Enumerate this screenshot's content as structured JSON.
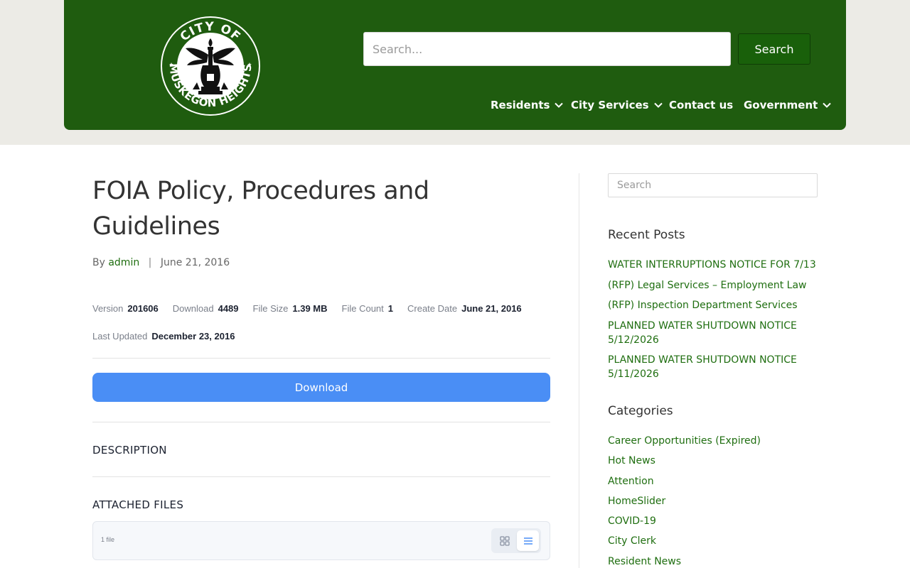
{
  "header": {
    "logo": {
      "text_top": "CITY OF",
      "text_bottom": "MUSKEGON HEIGHTS"
    },
    "search": {
      "placeholder": "Search...",
      "button_label": "Search"
    },
    "nav": [
      {
        "label": "Residents",
        "has_dropdown": true
      },
      {
        "label": "City Services",
        "has_dropdown": true
      },
      {
        "label": "Contact us",
        "has_dropdown": false
      },
      {
        "label": "Government",
        "has_dropdown": true
      }
    ]
  },
  "article": {
    "title": "FOIA Policy, Procedures and Guidelines",
    "byline_prefix": "By",
    "author": "admin",
    "separator": "|",
    "date": "June 21, 2016",
    "meta": {
      "version_label": "Version",
      "version_value": "201606",
      "download_label": "Download",
      "download_value": "4489",
      "filesize_label": "File Size",
      "filesize_value": "1.39 MB",
      "filecount_label": "File Count",
      "filecount_value": "1",
      "createdate_label": "Create Date",
      "createdate_value": "June 21, 2016",
      "lastupdated_label": "Last Updated",
      "lastupdated_value": "December 23, 2016"
    },
    "download_button": "Download",
    "description_heading": "DESCRIPTION",
    "attached_heading": "ATTACHED FILES",
    "files_count_text": "1 file"
  },
  "sidebar": {
    "search_placeholder": "Search",
    "recent_posts_title": "Recent Posts",
    "recent_posts": [
      "WATER INTERRUPTIONS NOTICE FOR 7/13",
      "(RFP) Legal Services – Employment Law",
      "(RFP) Inspection Department Services",
      "PLANNED WATER SHUTDOWN NOTICE 5/12/2026",
      "PLANNED WATER SHUTDOWN NOTICE 5/11/2026"
    ],
    "categories_title": "Categories",
    "categories": [
      "Career Opportunities (Expired)",
      "Hot News",
      "Attention",
      "HomeSlider",
      "COVID-19",
      "City Clerk",
      "Resident News"
    ]
  },
  "colors": {
    "header_green": "#1f5c0f",
    "link_green": "#1f6e10",
    "download_blue": "#4a8ef5"
  }
}
